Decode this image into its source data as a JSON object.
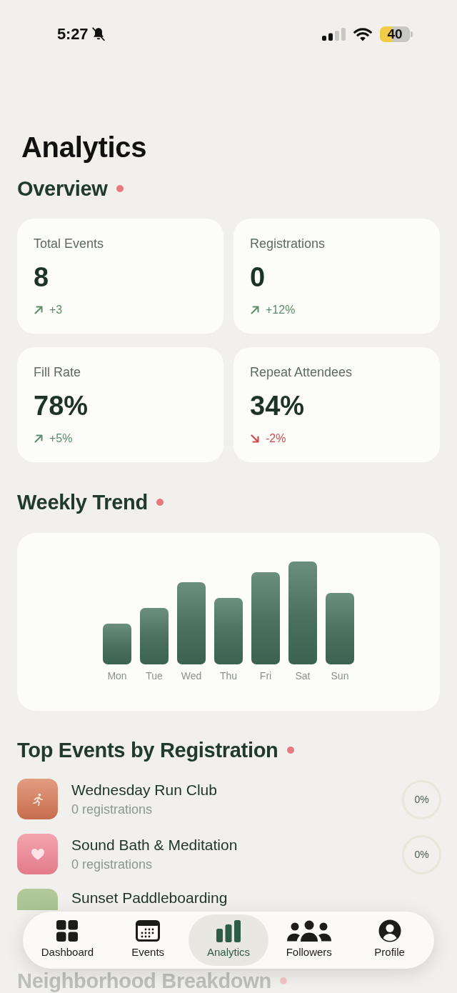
{
  "status_bar": {
    "time": "5:27",
    "battery": "40"
  },
  "page_title": "Analytics",
  "overview": {
    "heading": "Overview",
    "stats": [
      {
        "label": "Total Events",
        "value": "8",
        "change": "+3",
        "kind": "up"
      },
      {
        "label": "Registrations",
        "value": "0",
        "change": "+12%",
        "kind": "up"
      },
      {
        "label": "Fill Rate",
        "value": "78%",
        "change": "+5%",
        "kind": "up"
      },
      {
        "label": "Repeat Attendees",
        "value": "34%",
        "change": "-2%",
        "kind": "down"
      }
    ]
  },
  "weekly_trend": {
    "heading": "Weekly Trend",
    "days": [
      "Mon",
      "Tue",
      "Wed",
      "Thu",
      "Fri",
      "Sat",
      "Sun"
    ]
  },
  "top_events": {
    "heading": "Top Events by Registration",
    "events": [
      {
        "kind": "runner",
        "title": "Wednesday Run Club",
        "subtitle": "0 registrations",
        "percent": "0%"
      },
      {
        "kind": "heart",
        "title": "Sound Bath & Meditation",
        "subtitle": "0 registrations",
        "percent": "0%"
      },
      {
        "kind": "blank",
        "title": "Sunset Paddleboarding"
      }
    ]
  },
  "next_section": {
    "heading": "Neighborhood Breakdown"
  },
  "tab_bar": [
    {
      "kind": "grid",
      "label": "Dashboard",
      "selected": false
    },
    {
      "kind": "calendar",
      "label": "Events",
      "selected": false
    },
    {
      "kind": "bars",
      "label": "Analytics",
      "selected": true
    },
    {
      "kind": "people",
      "label": "Followers",
      "selected": false
    },
    {
      "kind": "person",
      "label": "Profile",
      "selected": false
    }
  ]
}
